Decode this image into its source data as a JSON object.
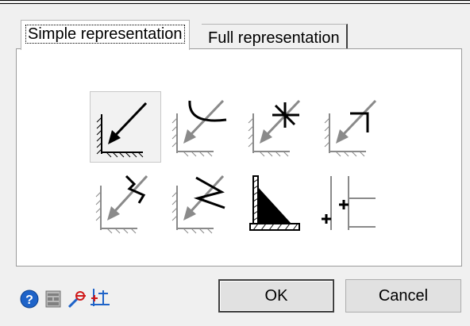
{
  "tabs": [
    {
      "label": "Simple representation",
      "active": true
    },
    {
      "label": "Full representation",
      "active": false
    }
  ],
  "symbols": [
    {
      "name": "arrow",
      "selected": true
    },
    {
      "name": "arc-arrow",
      "selected": false
    },
    {
      "name": "star-arrow",
      "selected": false
    },
    {
      "name": "corner-arrow",
      "selected": false
    },
    {
      "name": "bracket-arrow",
      "selected": false
    },
    {
      "name": "zigzag-arrow",
      "selected": false
    },
    {
      "name": "filled-triangle",
      "selected": false
    },
    {
      "name": "plus-grid",
      "selected": false
    }
  ],
  "toolbar_icons": [
    "help-icon",
    "library-icon",
    "pick-icon",
    "axis-icon"
  ],
  "buttons": {
    "ok": "OK",
    "cancel": "Cancel"
  },
  "colors": {
    "help_blue": "#1e63c8",
    "icon_red": "#d01818"
  }
}
